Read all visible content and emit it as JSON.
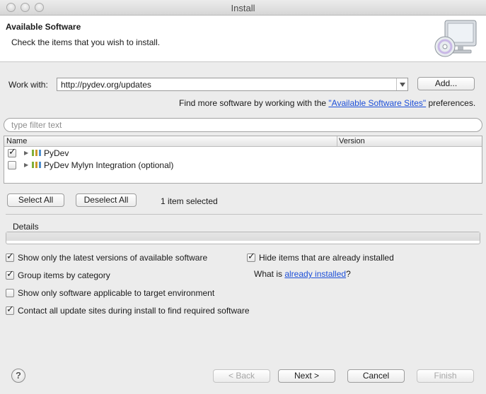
{
  "window": {
    "title": "Install"
  },
  "header": {
    "title": "Available Software",
    "description": "Check the items that you wish to install."
  },
  "work_with": {
    "label": "Work with:",
    "value": "http://pydev.org/updates",
    "add_button": "Add..."
  },
  "find_more": {
    "prefix": "Find more software by working with the ",
    "link": "\"Available Software Sites\"",
    "suffix": " preferences."
  },
  "filter": {
    "placeholder": "type filter text",
    "value": ""
  },
  "table": {
    "columns": [
      "Name",
      "Version"
    ],
    "rows": [
      {
        "name": "PyDev",
        "version": "",
        "checked": true
      },
      {
        "name": "PyDev Mylyn Integration (optional)",
        "version": "",
        "checked": false
      }
    ]
  },
  "selection": {
    "select_all": "Select All",
    "deselect_all": "Deselect All",
    "status": "1 item selected"
  },
  "details": {
    "label": "Details"
  },
  "options": {
    "latest_versions": {
      "label": "Show only the latest versions of available software",
      "checked": true
    },
    "hide_installed": {
      "label": "Hide items that are already installed",
      "checked": true
    },
    "group_by_category": {
      "label": "Group items by category",
      "checked": true
    },
    "what_is_prefix": "What is ",
    "what_is_link": "already installed",
    "what_is_suffix": "?",
    "target_env": {
      "label": "Show only software applicable to target environment",
      "checked": false
    },
    "contact_sites": {
      "label": "Contact all update sites during install to find required software",
      "checked": true
    }
  },
  "footer": {
    "help": "?",
    "back": "< Back",
    "next": "Next >",
    "cancel": "Cancel",
    "finish": "Finish"
  }
}
